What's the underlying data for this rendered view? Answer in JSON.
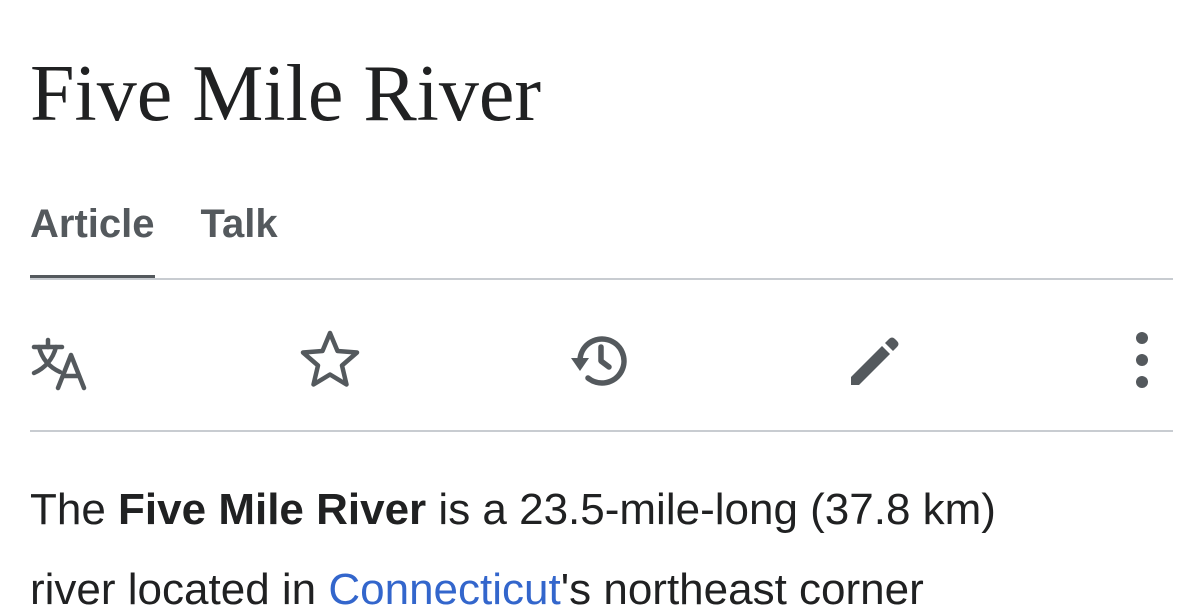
{
  "page": {
    "title": "Five Mile River"
  },
  "tabs": [
    {
      "label": "Article",
      "active": true
    },
    {
      "label": "Talk",
      "active": false
    }
  ],
  "toolbar": {
    "icons": [
      "language-icon",
      "star-icon",
      "history-icon",
      "edit-pencil-icon",
      "more-vertical-icon"
    ],
    "icon_color": "#54595d"
  },
  "colors": {
    "text": "#202122",
    "link": "#3366cc",
    "divider": "#c8ccd1",
    "tab_text": "#54595d"
  },
  "content": {
    "intro_before_bold": "The ",
    "bold_name": "Five Mile River",
    "intro_after_bold": " is a 23.5-mile-long (37.8 km)",
    "line2_before_link": "river located in ",
    "link_connecticut": "Connecticut",
    "line2_after_link": "'s northeast corner"
  }
}
